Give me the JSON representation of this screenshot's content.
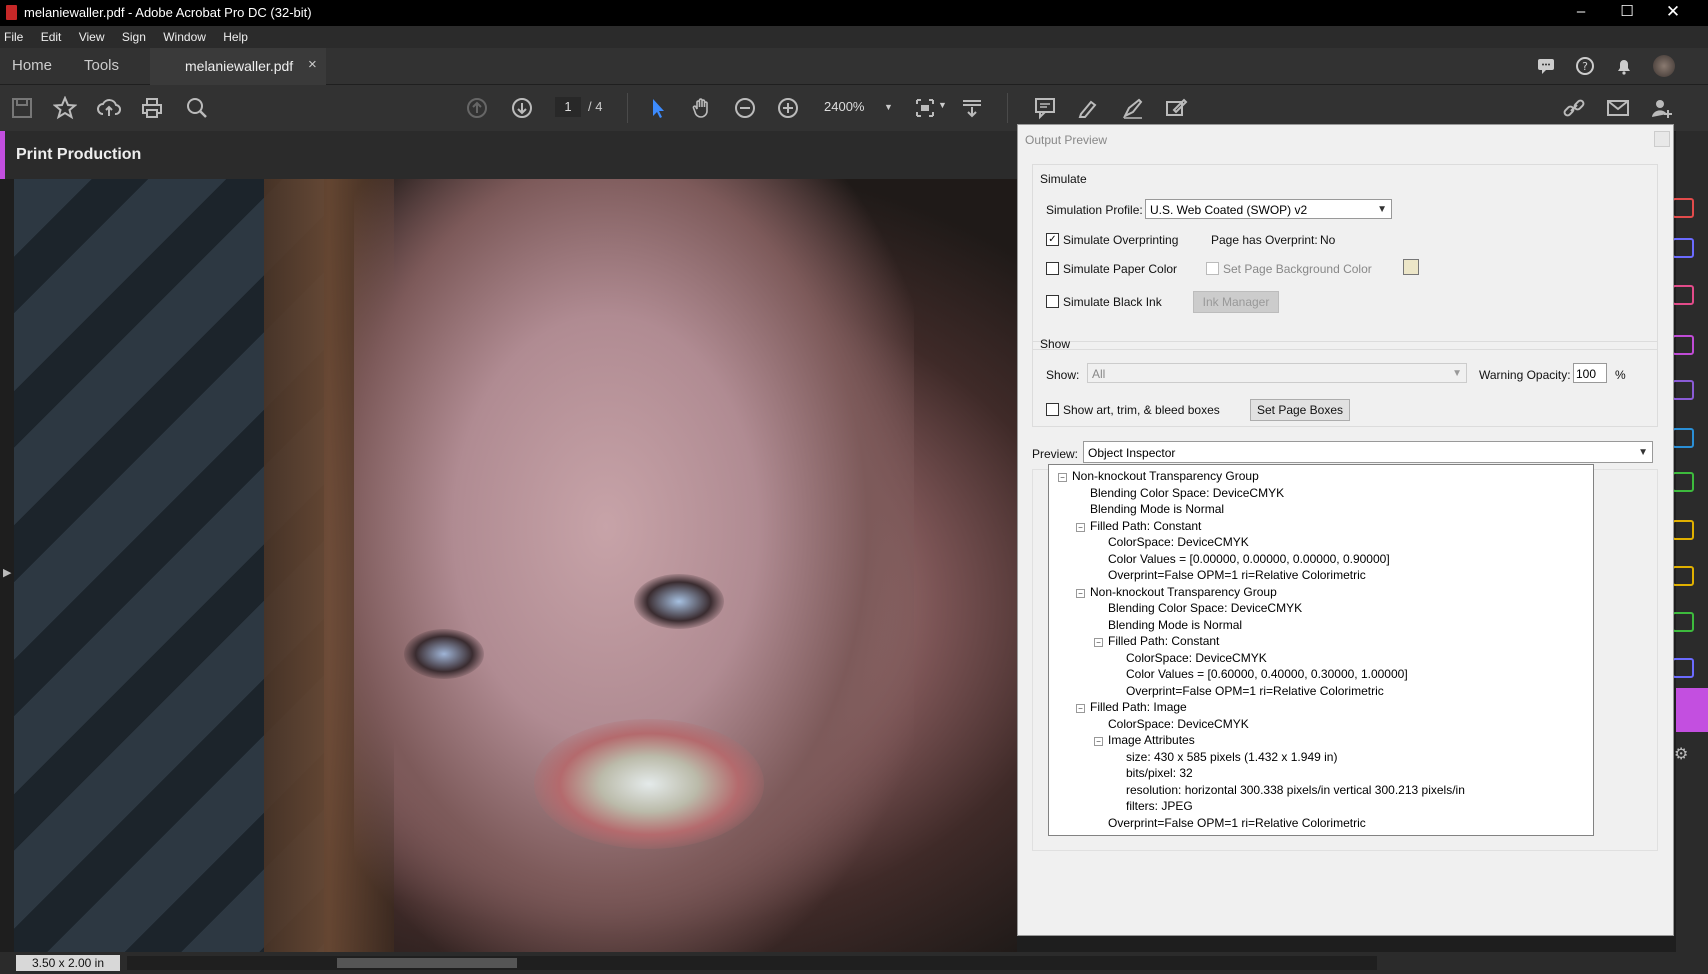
{
  "window": {
    "title": "melaniewaller.pdf - Adobe Acrobat Pro DC (32-bit)"
  },
  "menu": [
    "File",
    "Edit",
    "View",
    "Sign",
    "Window",
    "Help"
  ],
  "tabs": {
    "home": "Home",
    "tools": "Tools",
    "doc": "melaniewaller.pdf",
    "close": "×"
  },
  "toolbar": {
    "page_current": "1",
    "page_total": "/ 4",
    "zoom": "2400%"
  },
  "panel": {
    "title": "Print Production"
  },
  "status": {
    "size": "3.50 x 2.00 in"
  },
  "dialog": {
    "title": "Output Preview",
    "simulate": {
      "group_label": "Simulate",
      "profile_label": "Simulation Profile:",
      "profile_value": "U.S. Web Coated (SWOP) v2",
      "overprint_label": "Simulate Overprinting",
      "overprint_checked": true,
      "page_has_overprint_label": "Page has Overprint:",
      "page_has_overprint_value": "No",
      "paper_color_label": "Simulate Paper Color",
      "bg_color_label": "Set Page Background Color",
      "black_ink_label": "Simulate Black Ink",
      "ink_manager_label": "Ink Manager"
    },
    "show": {
      "group_label": "Show",
      "show_label": "Show:",
      "show_value": "All",
      "warning_label": "Warning Opacity:",
      "warning_value": "100",
      "warning_unit": "%",
      "boxes_label": "Show art, trim, & bleed boxes",
      "set_boxes_label": "Set Page Boxes"
    },
    "preview": {
      "label": "Preview:",
      "value": "Object Inspector"
    },
    "tree": [
      {
        "text": "Non-knockout Transparency Group",
        "level": 0,
        "toggle": true
      },
      {
        "text": "Blending Color Space: DeviceCMYK",
        "level": 1
      },
      {
        "text": "Blending Mode is Normal",
        "level": 1
      },
      {
        "text": "Filled Path: Constant",
        "level": 1,
        "toggle": true
      },
      {
        "text": "ColorSpace: DeviceCMYK",
        "level": 2
      },
      {
        "text": "Color Values = [0.00000, 0.00000, 0.00000, 0.90000]",
        "level": 2
      },
      {
        "text": "Overprint=False OPM=1 ri=Relative Colorimetric",
        "level": 2
      },
      {
        "text": "Non-knockout Transparency Group",
        "level": 1,
        "toggle": true
      },
      {
        "text": "Blending Color Space: DeviceCMYK",
        "level": 2
      },
      {
        "text": "Blending Mode is Normal",
        "level": 2
      },
      {
        "text": "Filled Path: Constant",
        "level": 2,
        "toggle": true
      },
      {
        "text": "ColorSpace: DeviceCMYK",
        "level": 3
      },
      {
        "text": "Color Values = [0.60000, 0.40000, 0.30000, 1.00000]",
        "level": 3
      },
      {
        "text": "Overprint=False OPM=1 ri=Relative Colorimetric",
        "level": 3
      },
      {
        "text": "Filled Path: Image",
        "level": 1,
        "toggle": true
      },
      {
        "text": "ColorSpace: DeviceCMYK",
        "level": 2
      },
      {
        "text": "Image Attributes",
        "level": 2,
        "toggle": true
      },
      {
        "text": "size: 430 x 585 pixels (1.432 x 1.949 in)",
        "level": 3
      },
      {
        "text": "bits/pixel: 32",
        "level": 3
      },
      {
        "text": "resolution: horizontal 300.338 pixels/in vertical 300.213 pixels/in",
        "level": 3
      },
      {
        "text": "filters: JPEG",
        "level": 3
      },
      {
        "text": "Overprint=False OPM=1 ri=Relative Colorimetric",
        "level": 2
      }
    ]
  },
  "colors": {
    "accent": "#c34fe0",
    "toolbar_bg": "#323232",
    "select_tool": "#3d8bfd"
  },
  "icons": [
    "save-icon",
    "star-icon",
    "upload-icon",
    "print-icon",
    "zoom-search-icon",
    "page-up-icon",
    "page-down-icon",
    "select-arrow-icon",
    "hand-icon",
    "zoom-out-icon",
    "zoom-in-icon",
    "fit-page-icon",
    "scroll-mode-icon",
    "comment-icon",
    "highlight-icon",
    "sign-icon",
    "stamp-icon",
    "link-icon",
    "mail-icon",
    "add-user-icon",
    "chat-icon",
    "help-icon",
    "bell-icon",
    "avatar"
  ]
}
